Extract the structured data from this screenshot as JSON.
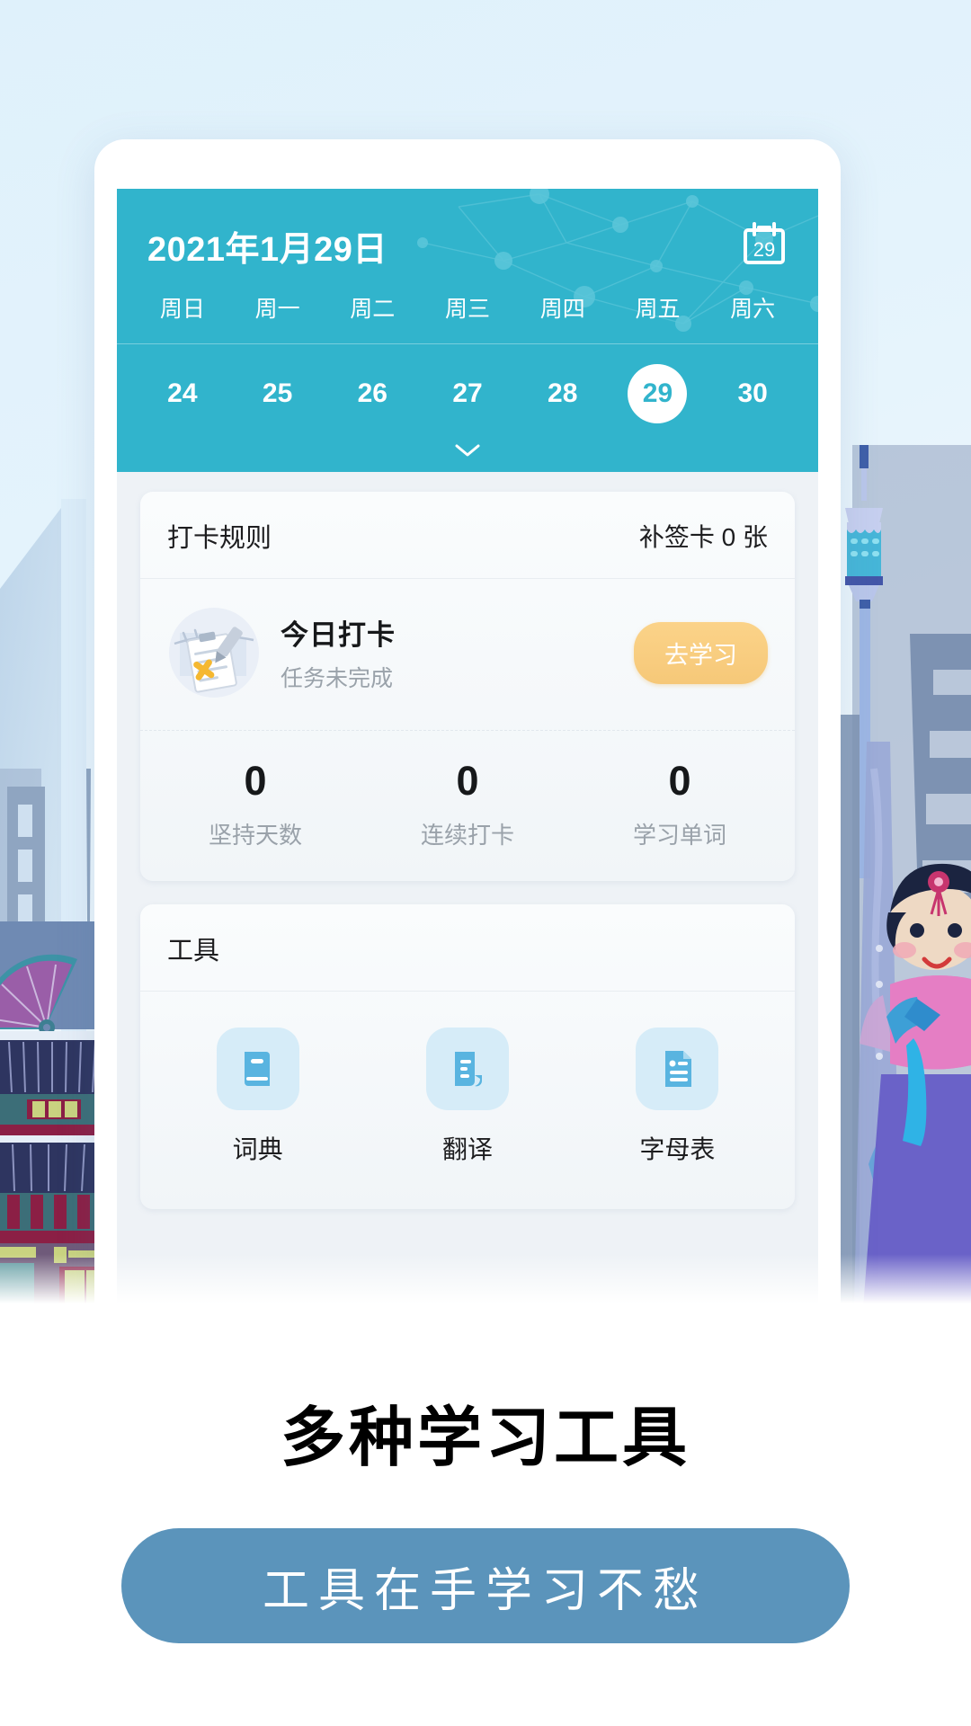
{
  "calendar": {
    "date_title": "2021年1月29日",
    "calendar_icon_day": "29",
    "weekdays": [
      "周日",
      "周一",
      "周二",
      "周三",
      "周四",
      "周五",
      "周六"
    ],
    "dates": [
      "24",
      "25",
      "26",
      "27",
      "28",
      "29",
      "30"
    ],
    "selected_date": "29",
    "header_color": "#31b4cc"
  },
  "checkin_card": {
    "rules_label": "打卡规则",
    "makeup_cards_label": "补签卡 0 张",
    "today_title": "今日打卡",
    "today_status": "任务未完成",
    "action_button": "去学习",
    "action_button_color": "#f6c878",
    "stats": [
      {
        "value": "0",
        "label": "坚持天数"
      },
      {
        "value": "0",
        "label": "连续打卡"
      },
      {
        "value": "0",
        "label": "学习单词"
      }
    ]
  },
  "tools_card": {
    "title": "工具",
    "items": [
      {
        "label": "词典",
        "icon": "book-icon"
      },
      {
        "label": "翻译",
        "icon": "translate-document-icon"
      },
      {
        "label": "字母表",
        "icon": "alphabet-file-icon"
      }
    ],
    "icon_color": "#59b4e0"
  },
  "promo": {
    "headline": "多种学习工具",
    "cta_label": "工具在手学习不愁",
    "cta_color": "#5b94bb"
  }
}
